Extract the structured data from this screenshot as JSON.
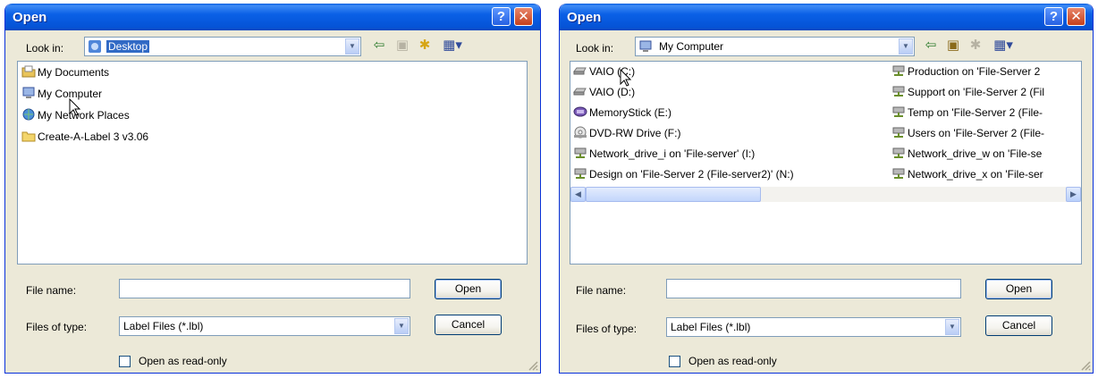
{
  "dialogs": [
    {
      "title": "Open",
      "look_in": {
        "label": "Look in:",
        "value": "Desktop",
        "icon": "desktop-icon",
        "selected": true
      },
      "files": [
        {
          "name": "My Documents",
          "icon": "my-documents-icon"
        },
        {
          "name": "My Computer",
          "icon": "my-computer-icon"
        },
        {
          "name": "My Network Places",
          "icon": "network-places-icon"
        },
        {
          "name": "Create-A-Label 3 v3.06",
          "icon": "folder-icon"
        }
      ],
      "file_name": {
        "label": "File name:",
        "value": ""
      },
      "files_of_type": {
        "label": "Files of type:",
        "value": "Label Files (*.lbl)"
      },
      "open_button": "Open",
      "cancel_button": "Cancel",
      "read_only": {
        "label": "Open as read-only",
        "checked": false
      }
    },
    {
      "title": "Open",
      "look_in": {
        "label": "Look in:",
        "value": "My Computer",
        "icon": "my-computer-icon",
        "selected": false
      },
      "files": [
        {
          "name": "VAIO (C:)",
          "icon": "hard-drive-icon"
        },
        {
          "name": "VAIO (D:)",
          "icon": "hard-drive-icon"
        },
        {
          "name": "MemoryStick (E:)",
          "icon": "memorystick-icon"
        },
        {
          "name": "DVD-RW Drive (F:)",
          "icon": "dvd-drive-icon"
        },
        {
          "name": "Network_drive_i on 'File-server' (I:)",
          "icon": "network-drive-icon"
        },
        {
          "name": "Design on 'File-Server 2 (File-server2)' (N:)",
          "icon": "network-drive-icon"
        },
        {
          "name": "Production on 'File-Server 2",
          "icon": "network-drive-icon"
        },
        {
          "name": "Support on 'File-Server 2 (Fil",
          "icon": "network-drive-icon"
        },
        {
          "name": "Temp on 'File-Server 2 (File-",
          "icon": "network-drive-icon"
        },
        {
          "name": "Users on 'File-Server 2 (File-",
          "icon": "network-drive-icon"
        },
        {
          "name": "Network_drive_w on 'File-se",
          "icon": "network-drive-icon"
        },
        {
          "name": "Network_drive_x on 'File-ser",
          "icon": "network-drive-icon"
        }
      ],
      "file_name": {
        "label": "File name:",
        "value": ""
      },
      "files_of_type": {
        "label": "Files of type:",
        "value": "Label Files (*.lbl)"
      },
      "open_button": "Open",
      "cancel_button": "Cancel",
      "read_only": {
        "label": "Open as read-only",
        "checked": false
      }
    }
  ],
  "colors": {
    "titlebar": "#0a60e6",
    "dialog_bg": "#ece9d8",
    "selection": "#316ac5",
    "close_button": "#c5401b",
    "help_button": "#2560e2"
  }
}
